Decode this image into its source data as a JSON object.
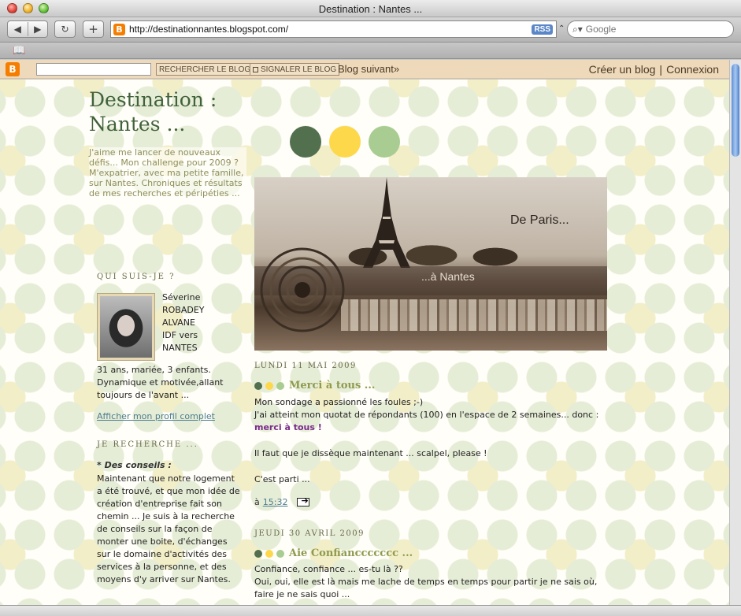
{
  "window": {
    "title": "Destination : Nantes ..."
  },
  "toolbar": {
    "url": "http://destinationnantes.blogspot.com/",
    "rss_label": "RSS",
    "search_placeholder": "Google",
    "back_glyph": "◀",
    "forward_glyph": "▶",
    "reload_glyph": "↻",
    "add_glyph": "+"
  },
  "navbar": {
    "search_button": "RECHERCHER LE BLOG",
    "flag_button": "SIGNALER LE BLOG",
    "next_blog": "Blog suivant»",
    "create_blog": "Créer un blog",
    "separator": "|",
    "login": "Connexion"
  },
  "blog": {
    "title_line1": "Destination :",
    "title_line2": "Nantes ...",
    "description": "J'aime me lancer de nouveaux défis... Mon challenge pour 2009 ? M'expatrier, avec ma petite famille, sur Nantes. Chroniques et résultats de mes recherches et péripéties ...",
    "dot_colors": [
      "#52704e",
      "#fed84b",
      "#a8cc91"
    ],
    "header_image": {
      "text_top": "De Paris...",
      "text_band": "...à Nantes"
    }
  },
  "sidebar": {
    "about_heading": "QUI SUIS-JE ?",
    "profile_name_lines": [
      "Séverine",
      "ROBADEY",
      "ALVANE",
      "IDF vers",
      "NANTES"
    ],
    "profile_about": "31 ans, mariée, 3 enfants. Dynamique et motivée,allant toujours de l'avant ...",
    "profile_link": "Afficher mon profil complet",
    "search_heading": "JE RECHERCHE ...",
    "search_strong": "* Des conseils :",
    "search_body": "Maintenant que notre logement a été trouvé, et que mon idée de création d'entreprise fait son chemin ... Je suis à la recherche de conseils sur la façon de monter une boite, d'échanges sur le domaine d'activités des services à la personne, et des moyens d'y arriver sur Nantes."
  },
  "posts": [
    {
      "date": "LUNDI 11 MAI 2009",
      "title": "Merci à tous ...",
      "line1": "Mon sondage a passionné les foules ;-)",
      "line2": "J'ai atteint mon quotat de répondants (100) en l'espace de 2 semaines... donc :",
      "strong": "merci à tous !",
      "line3": "Il faut que je dissèque maintenant ... scalpel, please !",
      "line4": "C'est parti ...",
      "footer_prefix": "à",
      "time": "15:32"
    },
    {
      "date": "JEUDI 30 AVRIL 2009",
      "title": "Aie Confianccccccc ...",
      "line1": "Confiance, confiance ... es-tu là ??",
      "line2": "Oui, oui, elle est là mais me lache de temps en temps pour partir je ne sais où,",
      "line3": "faire je ne sais quoi ..."
    }
  ],
  "colors": {
    "title_green": "#41623a",
    "post_title": "#8e9a4e",
    "link": "#4d7d90",
    "highlight_purple": "#7a2a8a"
  }
}
